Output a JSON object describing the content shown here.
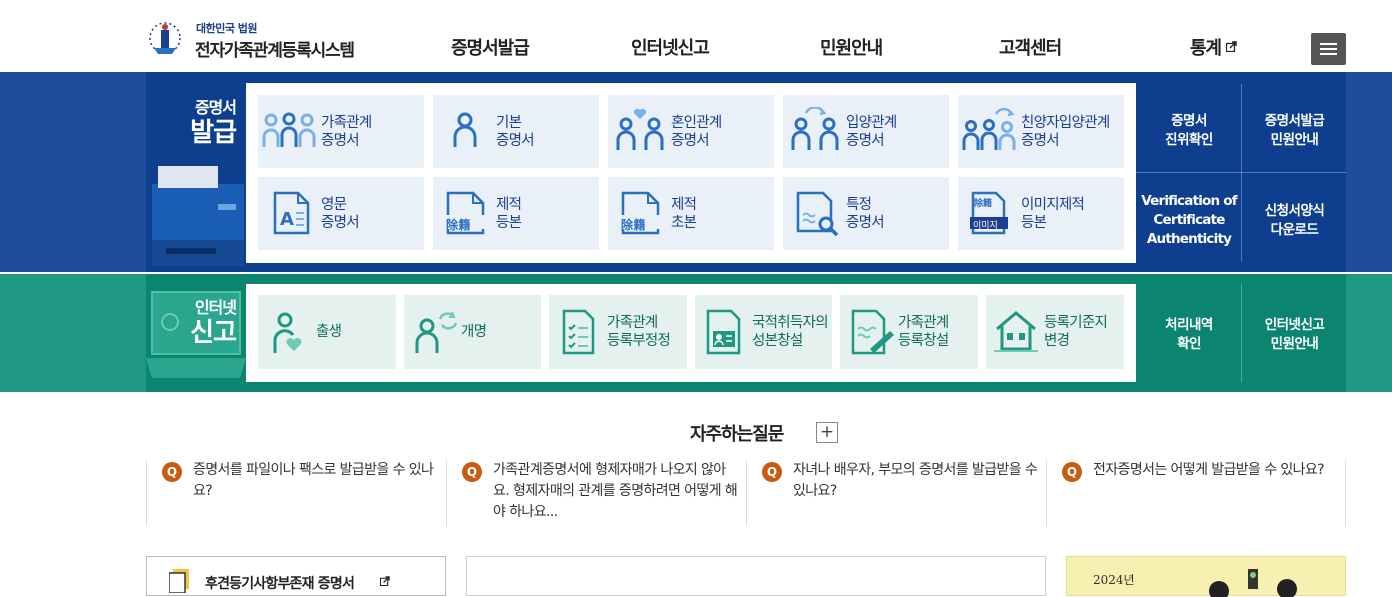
{
  "header": {
    "logo_small": "대한민국 법원",
    "logo_title": "전자가족관계등록시스템",
    "nav": [
      "증명서발급",
      "인터넷신고",
      "민원안내",
      "고객센터",
      "통계"
    ],
    "external_icon": "external-link-icon",
    "menu_icon": "hamburger-menu-icon"
  },
  "issue": {
    "title_small": "증명서",
    "title_big": "발급",
    "tiles": [
      {
        "line1": "가족관계",
        "line2": "증명서",
        "icon": "family-icon"
      },
      {
        "line1": "기본",
        "line2": "증명서",
        "icon": "person-icon"
      },
      {
        "line1": "혼인관계",
        "line2": "증명서",
        "icon": "couple-heart-icon"
      },
      {
        "line1": "입양관계",
        "line2": "증명서",
        "icon": "adoption-icon"
      },
      {
        "line1": "친양자입양관계",
        "line2": "증명서",
        "icon": "family-adoption-icon"
      },
      {
        "line1": "영문",
        "line2": "증명서",
        "icon": "english-document-icon"
      },
      {
        "line1": "제적",
        "line2": "등본",
        "icon": "removal-register-icon",
        "stamp": "除籍"
      },
      {
        "line1": "제적",
        "line2": "초본",
        "icon": "removal-register-icon",
        "stamp": "除籍"
      },
      {
        "line1": "특정",
        "line2": "증명서",
        "icon": "document-search-icon"
      },
      {
        "line1": "이미지제적",
        "line2": "등본",
        "icon": "image-register-icon",
        "stamp_top": "除籍",
        "stamp_label": "이미지"
      }
    ],
    "side": [
      {
        "line1": "증명서",
        "line2": "진위확인"
      },
      {
        "line1": "증명서발급",
        "line2": "민원안내"
      },
      {
        "line1": "Verification of",
        "line2": "Certificate",
        "line3": "Authenticity"
      },
      {
        "line1": "신청서양식",
        "line2": "다운로드"
      }
    ]
  },
  "report": {
    "title_small": "인터넷",
    "title_big": "신고",
    "tiles": [
      {
        "line1": "출생",
        "line2": "",
        "icon": "birth-icon"
      },
      {
        "line1": "개명",
        "line2": "",
        "icon": "rename-icon"
      },
      {
        "line1": "가족관계",
        "line2": "등록부정정",
        "icon": "checklist-document-icon"
      },
      {
        "line1": "국적취득자의",
        "line2": "성본창설",
        "icon": "id-card-document-icon"
      },
      {
        "line1": "가족관계",
        "line2": "등록창설",
        "icon": "pen-document-icon"
      },
      {
        "line1": "등록기준지",
        "line2": "변경",
        "icon": "house-icon"
      }
    ],
    "side": [
      {
        "line1": "처리내역",
        "line2": "확인"
      },
      {
        "line1": "인터넷신고",
        "line2": "민원안내"
      }
    ]
  },
  "faq": {
    "title": "자주하는질문",
    "plus": "+",
    "badge": "Q",
    "items": [
      "증명서를 파일이나 팩스로 발급받을 수 있나요?",
      "가족관계증명서에 형제자매가 나오지 않아요. 형제자매의 관계를 증명하려면 어떻게 해야 하나요...",
      "자녀나 배우자, 부모의 증명서를 발급받을 수 있나요?",
      "전자증명서는 어떻게 발급받을 수 있나요?"
    ]
  },
  "bottom": {
    "box1_title": "후견등기사항부존재 증명서",
    "banner_text": "2024년"
  },
  "colors": {
    "issue_band": "#0e3f8f",
    "report_band": "#0b8570",
    "tile_blue": "#eaf0f8",
    "icon_blue": "#2a6fc0",
    "icon_green": "#1e9882",
    "faq_badge": "#c75b12"
  }
}
